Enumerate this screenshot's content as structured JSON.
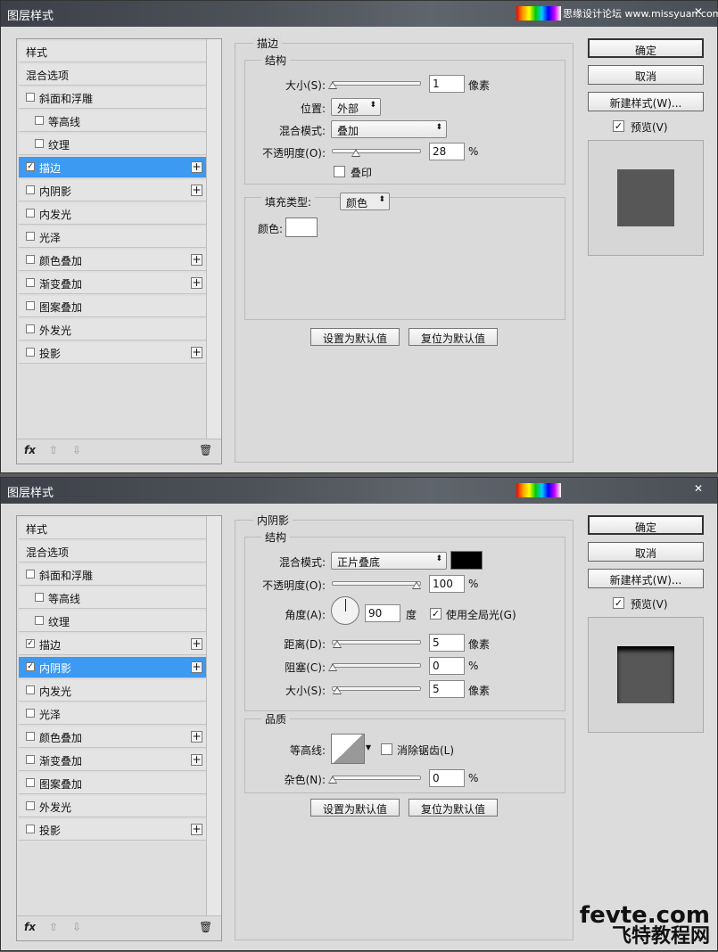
{
  "watermark_top": "思缘设计论坛 www.missyuan.com",
  "brand": {
    "line1": "fevte.com",
    "line2": "飞特教程网"
  },
  "dialogs": [
    {
      "title": "图层样式",
      "styles": [
        {
          "label": "样式",
          "checkbox": false,
          "checked": false,
          "plus": false,
          "indent": 0
        },
        {
          "label": "混合选项",
          "checkbox": false,
          "checked": false,
          "plus": false,
          "indent": 0
        },
        {
          "label": "斜面和浮雕",
          "checkbox": true,
          "checked": false,
          "plus": false,
          "indent": 0
        },
        {
          "label": "等高线",
          "checkbox": true,
          "checked": false,
          "plus": false,
          "indent": 1
        },
        {
          "label": "纹理",
          "checkbox": true,
          "checked": false,
          "plus": false,
          "indent": 1
        },
        {
          "label": "描边",
          "checkbox": true,
          "checked": true,
          "plus": true,
          "indent": 0,
          "selected": true
        },
        {
          "label": "内阴影",
          "checkbox": true,
          "checked": false,
          "plus": true,
          "indent": 0
        },
        {
          "label": "内发光",
          "checkbox": true,
          "checked": false,
          "plus": false,
          "indent": 0
        },
        {
          "label": "光泽",
          "checkbox": true,
          "checked": false,
          "plus": false,
          "indent": 0
        },
        {
          "label": "颜色叠加",
          "checkbox": true,
          "checked": false,
          "plus": true,
          "indent": 0
        },
        {
          "label": "渐变叠加",
          "checkbox": true,
          "checked": false,
          "plus": true,
          "indent": 0
        },
        {
          "label": "图案叠加",
          "checkbox": true,
          "checked": false,
          "plus": false,
          "indent": 0
        },
        {
          "label": "外发光",
          "checkbox": true,
          "checked": false,
          "plus": false,
          "indent": 0
        },
        {
          "label": "投影",
          "checkbox": true,
          "checked": false,
          "plus": true,
          "indent": 0
        }
      ],
      "footer": {
        "fx": "fx",
        "up": "⇧",
        "down": "⇩",
        "trash": "🗑"
      },
      "panel": {
        "title": "描边",
        "structure": {
          "title": "结构",
          "size_label": "大小(S):",
          "size_value": "1",
          "size_unit": "像素",
          "size_pct": 0,
          "position_label": "位置:",
          "position_value": "外部",
          "blend_label": "混合模式:",
          "blend_value": "叠加",
          "opacity_label": "不透明度(O):",
          "opacity_value": "28",
          "opacity_unit": "%",
          "opacity_pct": 28,
          "overprint_label": "叠印",
          "overprint_checked": false
        },
        "fill": {
          "type_label": "填充类型:",
          "type_value": "颜色",
          "color_label": "颜色:",
          "color": "#ffffff"
        },
        "set_default": "设置为默认值",
        "reset_default": "复位为默认值"
      },
      "buttons": {
        "ok": "确定",
        "cancel": "取消",
        "new_style": "新建样式(W)...",
        "preview": "预览(V)",
        "preview_checked": true
      }
    },
    {
      "title": "图层样式",
      "styles": [
        {
          "label": "样式",
          "checkbox": false,
          "checked": false,
          "plus": false,
          "indent": 0
        },
        {
          "label": "混合选项",
          "checkbox": false,
          "checked": false,
          "plus": false,
          "indent": 0
        },
        {
          "label": "斜面和浮雕",
          "checkbox": true,
          "checked": false,
          "plus": false,
          "indent": 0
        },
        {
          "label": "等高线",
          "checkbox": true,
          "checked": false,
          "plus": false,
          "indent": 1
        },
        {
          "label": "纹理",
          "checkbox": true,
          "checked": false,
          "plus": false,
          "indent": 1
        },
        {
          "label": "描边",
          "checkbox": true,
          "checked": true,
          "plus": true,
          "indent": 0
        },
        {
          "label": "内阴影",
          "checkbox": true,
          "checked": true,
          "plus": true,
          "indent": 0,
          "selected": true
        },
        {
          "label": "内发光",
          "checkbox": true,
          "checked": false,
          "plus": false,
          "indent": 0
        },
        {
          "label": "光泽",
          "checkbox": true,
          "checked": false,
          "plus": false,
          "indent": 0
        },
        {
          "label": "颜色叠加",
          "checkbox": true,
          "checked": false,
          "plus": true,
          "indent": 0
        },
        {
          "label": "渐变叠加",
          "checkbox": true,
          "checked": false,
          "plus": true,
          "indent": 0
        },
        {
          "label": "图案叠加",
          "checkbox": true,
          "checked": false,
          "plus": false,
          "indent": 0
        },
        {
          "label": "外发光",
          "checkbox": true,
          "checked": false,
          "plus": false,
          "indent": 0
        },
        {
          "label": "投影",
          "checkbox": true,
          "checked": false,
          "plus": true,
          "indent": 0
        }
      ],
      "footer": {
        "fx": "fx",
        "up": "⇧",
        "down": "⇩",
        "trash": "🗑"
      },
      "panel": {
        "title": "内阴影",
        "structure": {
          "title": "结构",
          "blend_label": "混合模式:",
          "blend_value": "正片叠底",
          "shadow_color": "#000000",
          "opacity_label": "不透明度(O):",
          "opacity_value": "100",
          "opacity_unit": "%",
          "opacity_pct": 100,
          "angle_label": "角度(A):",
          "angle_value": "90",
          "angle_unit": "度",
          "global_light_label": "使用全局光(G)",
          "global_light_checked": true,
          "distance_label": "距离(D):",
          "distance_value": "5",
          "distance_unit": "像素",
          "distance_pct": 5,
          "choke_label": "阻塞(C):",
          "choke_value": "0",
          "choke_unit": "%",
          "choke_pct": 0,
          "size_label": "大小(S):",
          "size_value": "5",
          "size_unit": "像素",
          "size_pct": 5
        },
        "quality": {
          "title": "品质",
          "contour_label": "等高线:",
          "antialias_label": "消除锯齿(L)",
          "antialias_checked": false,
          "noise_label": "杂色(N):",
          "noise_value": "0",
          "noise_unit": "%",
          "noise_pct": 0
        },
        "set_default": "设置为默认值",
        "reset_default": "复位为默认值"
      },
      "buttons": {
        "ok": "确定",
        "cancel": "取消",
        "new_style": "新建样式(W)...",
        "preview": "预览(V)",
        "preview_checked": true
      }
    }
  ]
}
